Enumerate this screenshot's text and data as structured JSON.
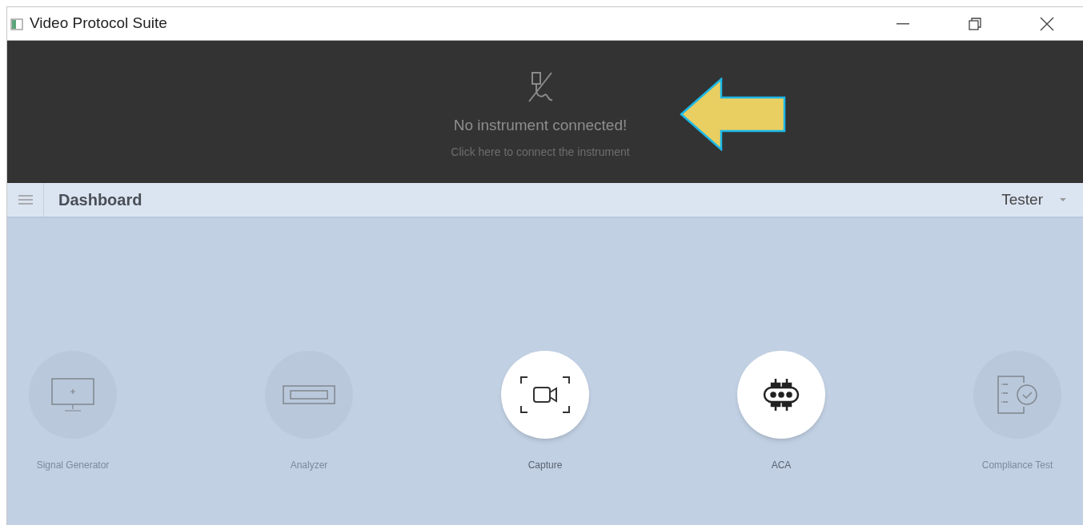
{
  "window": {
    "title": "Video Protocol Suite"
  },
  "banner": {
    "message": "No instrument connected!",
    "link": "Click here to connect the instrument"
  },
  "navbar": {
    "title": "Dashboard",
    "user": "Tester"
  },
  "modules": [
    {
      "kind": "monitor",
      "label": "Signal Generator",
      "disabled": true
    },
    {
      "kind": "connector",
      "label": "Analyzer",
      "disabled": true
    },
    {
      "kind": "camera",
      "label": "Capture",
      "disabled": false
    },
    {
      "kind": "chip",
      "label": "ACA",
      "disabled": false
    },
    {
      "kind": "checklist",
      "label": "Compliance Test",
      "disabled": true
    }
  ]
}
